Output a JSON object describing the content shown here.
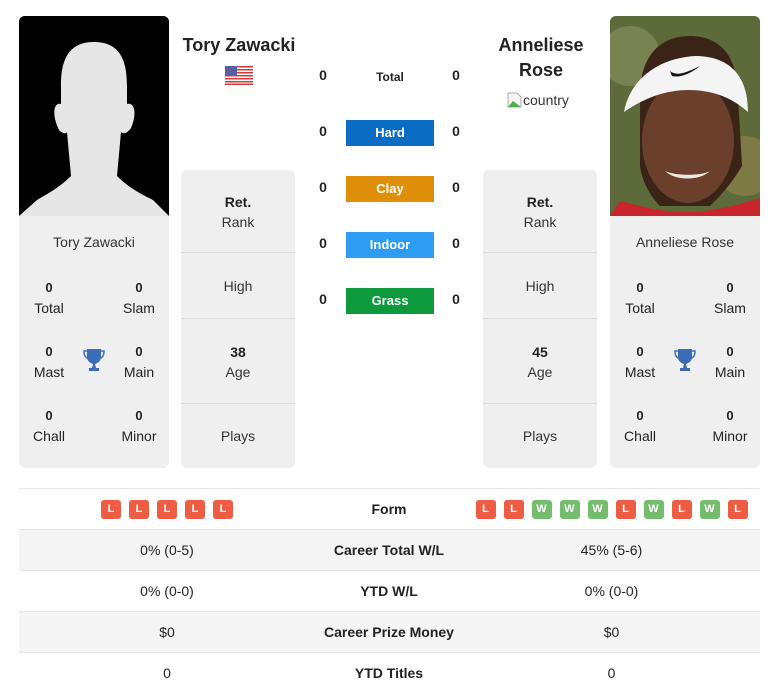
{
  "player_left": {
    "name": "Tory Zawacki",
    "card_name": "Tory Zawacki",
    "country_flag": "us-flag-icon",
    "titles": {
      "total": "0",
      "slam": "0",
      "mast": "0",
      "main": "0",
      "chall": "0",
      "minor": "0"
    },
    "titles_labels": {
      "total": "Total",
      "slam": "Slam",
      "mast": "Mast",
      "main": "Main",
      "chall": "Chall",
      "minor": "Minor"
    },
    "rank_value": "Ret.",
    "rank_label": "Rank",
    "high_label": "High",
    "age_value": "38",
    "age_label": "Age",
    "plays_label": "Plays"
  },
  "player_right": {
    "name_line1": "Anneliese",
    "name_line2": "Rose",
    "card_name": "Anneliese Rose",
    "country_alt": "country",
    "titles": {
      "total": "0",
      "slam": "0",
      "mast": "0",
      "main": "0",
      "chall": "0",
      "minor": "0"
    },
    "titles_labels": {
      "total": "Total",
      "slam": "Slam",
      "mast": "Mast",
      "main": "Main",
      "chall": "Chall",
      "minor": "Minor"
    },
    "rank_value": "Ret.",
    "rank_label": "Rank",
    "high_label": "High",
    "age_value": "45",
    "age_label": "Age",
    "plays_label": "Plays"
  },
  "h2h": [
    {
      "label": "Total",
      "left": "0",
      "right": "0",
      "color": ""
    },
    {
      "label": "Hard",
      "left": "0",
      "right": "0",
      "color": "#0a6cc2"
    },
    {
      "label": "Clay",
      "left": "0",
      "right": "0",
      "color": "#df8e08"
    },
    {
      "label": "Indoor",
      "left": "0",
      "right": "0",
      "color": "#2d9cf2"
    },
    {
      "label": "Grass",
      "left": "0",
      "right": "0",
      "color": "#0c9a3c"
    }
  ],
  "comparison": {
    "form_label": "Form",
    "form_left": [
      "L",
      "L",
      "L",
      "L",
      "L"
    ],
    "form_right": [
      "L",
      "L",
      "W",
      "W",
      "W",
      "L",
      "W",
      "L",
      "W",
      "L"
    ],
    "rows": [
      {
        "label": "Career Total W/L",
        "left": "0% (0-5)",
        "right": "45% (5-6)"
      },
      {
        "label": "YTD W/L",
        "left": "0% (0-0)",
        "right": "0% (0-0)"
      },
      {
        "label": "Career Prize Money",
        "left": "$0",
        "right": "$0"
      },
      {
        "label": "YTD Titles",
        "left": "0",
        "right": "0"
      }
    ]
  },
  "colors": {
    "loss": "#ee5c43",
    "win": "#73bd6d",
    "trophy": "#3a6db5"
  }
}
